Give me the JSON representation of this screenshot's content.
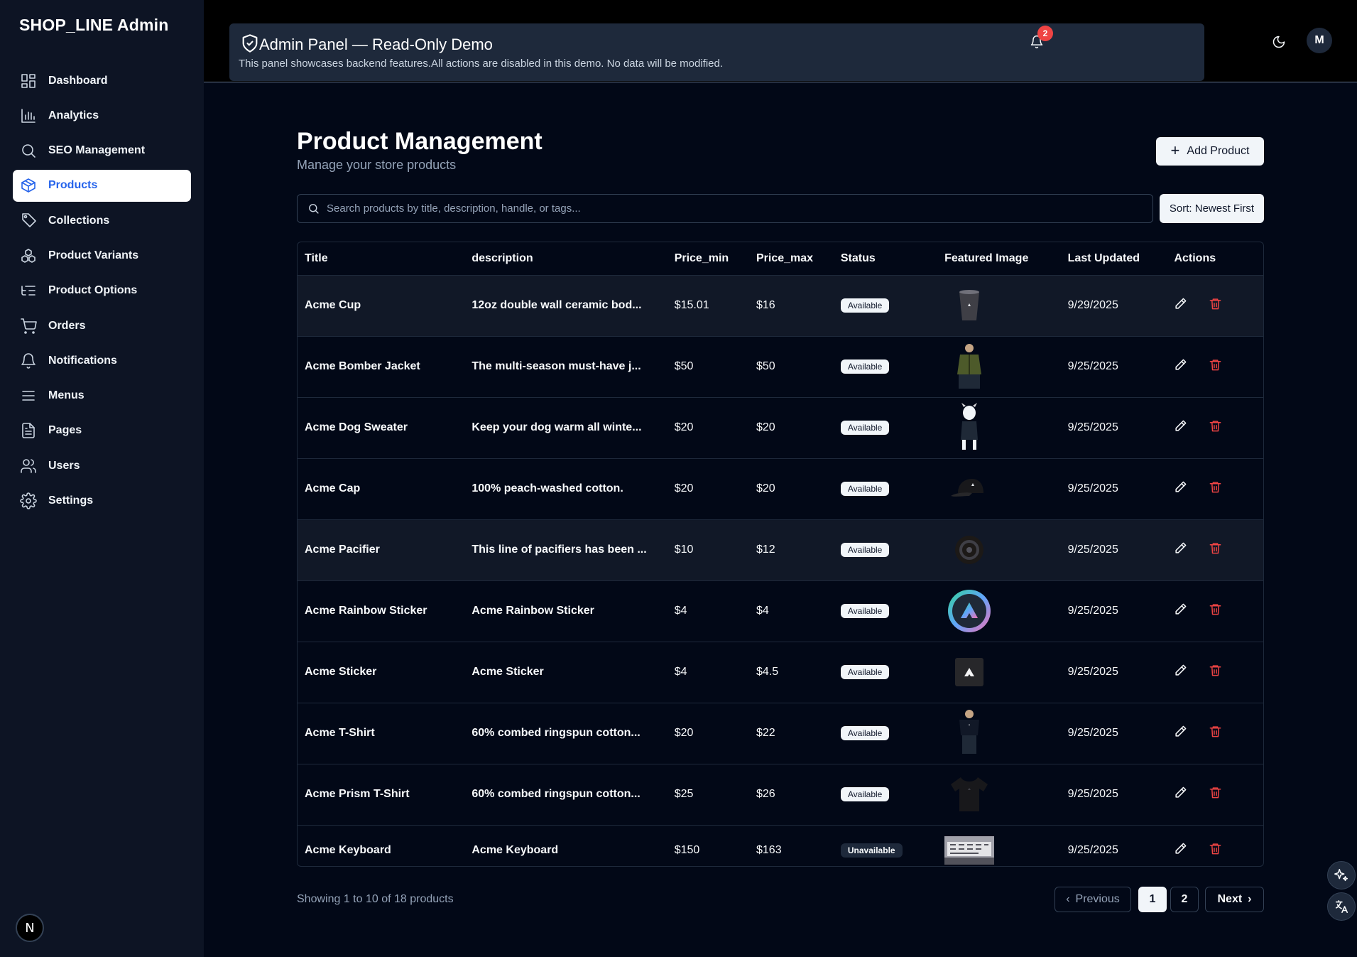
{
  "brand": "SHOP_LINE Admin",
  "nav": [
    {
      "label": "Dashboard",
      "icon": "dashboard-icon"
    },
    {
      "label": "Analytics",
      "icon": "bar-chart-icon"
    },
    {
      "label": "SEO Management",
      "icon": "search-icon"
    },
    {
      "label": "Products",
      "icon": "box-icon",
      "active": true
    },
    {
      "label": "Collections",
      "icon": "tag-icon"
    },
    {
      "label": "Product Variants",
      "icon": "boxes-icon"
    },
    {
      "label": "Product Options",
      "icon": "list-tree-icon"
    },
    {
      "label": "Orders",
      "icon": "cart-icon"
    },
    {
      "label": "Notifications",
      "icon": "bell-icon"
    },
    {
      "label": "Menus",
      "icon": "menu-icon"
    },
    {
      "label": "Pages",
      "icon": "file-icon"
    },
    {
      "label": "Users",
      "icon": "users-icon"
    },
    {
      "label": "Settings",
      "icon": "gear-icon"
    }
  ],
  "banner": {
    "title": "Admin Panel — Read-Only Demo",
    "text": "This panel showcases backend features.All actions are disabled in this demo. No data will be modified."
  },
  "header": {
    "notification_count": "2",
    "avatar_initial": "M"
  },
  "page": {
    "title": "Product Management",
    "subtitle": "Manage your store products",
    "add_label": "Add Product",
    "search_placeholder": "Search products by title, description, handle, or tags...",
    "sort_label": "Sort: Newest First"
  },
  "table": {
    "columns": [
      "Title",
      "description",
      "Price_min",
      "Price_max",
      "Status",
      "Featured Image",
      "Last Updated",
      "Actions"
    ],
    "rows": [
      {
        "title": "Acme Cup",
        "description": "12oz double wall ceramic bod...",
        "price_min": "$15.01",
        "price_max": "$16",
        "status": "Available",
        "image": "cup",
        "updated": "9/29/2025"
      },
      {
        "title": "Acme Bomber Jacket",
        "description": "The multi-season must-have j...",
        "price_min": "$50",
        "price_max": "$50",
        "status": "Available",
        "image": "jacket",
        "updated": "9/25/2025"
      },
      {
        "title": "Acme Dog Sweater",
        "description": "Keep your dog warm all winte...",
        "price_min": "$20",
        "price_max": "$20",
        "status": "Available",
        "image": "dog",
        "updated": "9/25/2025"
      },
      {
        "title": "Acme Cap",
        "description": "100% peach-washed cotton.",
        "price_min": "$20",
        "price_max": "$20",
        "status": "Available",
        "image": "cap",
        "updated": "9/25/2025"
      },
      {
        "title": "Acme Pacifier",
        "description": "This line of pacifiers has been ...",
        "price_min": "$10",
        "price_max": "$12",
        "status": "Available",
        "image": "pacifier",
        "updated": "9/25/2025"
      },
      {
        "title": "Acme Rainbow Sticker",
        "description": "Acme Rainbow Sticker",
        "price_min": "$4",
        "price_max": "$4",
        "status": "Available",
        "image": "rainbow-sticker",
        "updated": "9/25/2025"
      },
      {
        "title": "Acme Sticker",
        "description": "Acme Sticker",
        "price_min": "$4",
        "price_max": "$4.5",
        "status": "Available",
        "image": "sticker",
        "updated": "9/25/2025"
      },
      {
        "title": "Acme T-Shirt",
        "description": "60% combed ringspun cotton...",
        "price_min": "$20",
        "price_max": "$22",
        "status": "Available",
        "image": "tshirt-model",
        "updated": "9/25/2025"
      },
      {
        "title": "Acme Prism T-Shirt",
        "description": "60% combed ringspun cotton...",
        "price_min": "$25",
        "price_max": "$26",
        "status": "Available",
        "image": "tshirt",
        "updated": "9/25/2025"
      },
      {
        "title": "Acme Keyboard",
        "description": "Acme Keyboard",
        "price_min": "$150",
        "price_max": "$163",
        "status": "Unavailable",
        "image": "keyboard",
        "updated": "9/25/2025"
      }
    ]
  },
  "pagination": {
    "showing": "Showing 1 to 10 of 18 products",
    "previous": "Previous",
    "pages": [
      "1",
      "2"
    ],
    "next": "Next"
  },
  "colors": {
    "background": "#020817",
    "sidebar": "#0d1424",
    "accent": "#2563eb",
    "danger": "#ef4444"
  }
}
